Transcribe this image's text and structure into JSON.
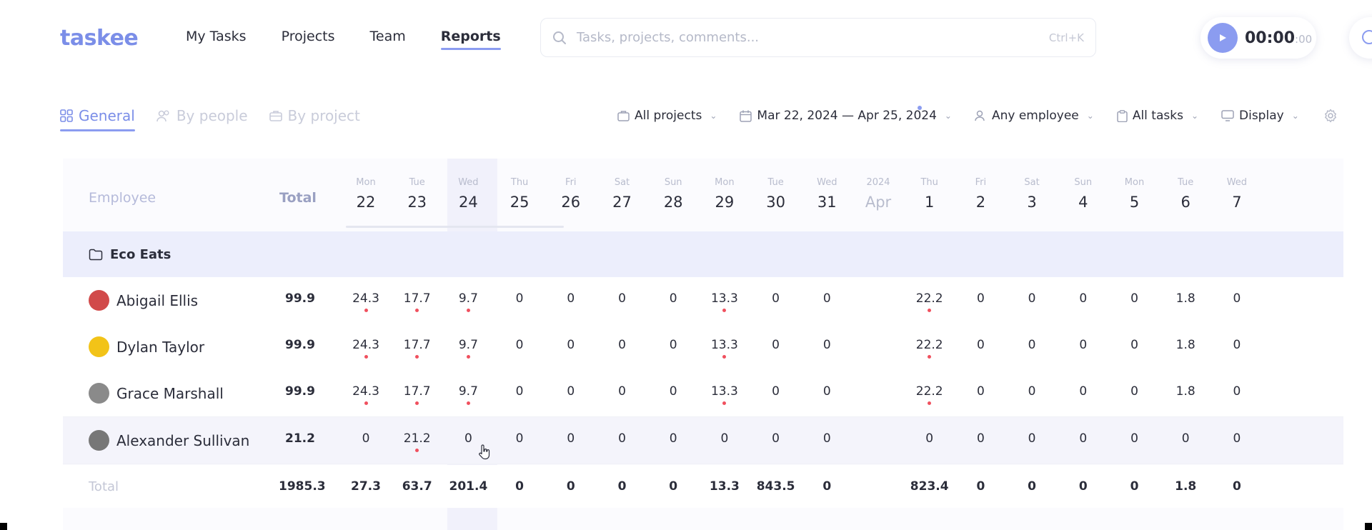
{
  "app": {
    "logo": "taskee"
  },
  "nav": {
    "items": [
      {
        "label": "My Tasks"
      },
      {
        "label": "Projects"
      },
      {
        "label": "Team"
      },
      {
        "label": "Reports"
      }
    ],
    "active": "Reports"
  },
  "search": {
    "placeholder": "Tasks, projects, comments...",
    "shortcut": "Ctrl+K"
  },
  "timer": {
    "main": "00:00",
    "seconds": ":00"
  },
  "view_tabs": [
    {
      "label": "General"
    },
    {
      "label": "By people"
    },
    {
      "label": "By project"
    }
  ],
  "filters": {
    "projects": "All projects",
    "date_range": "Mar 22, 2024 — Apr 25, 2024",
    "employee": "Any employee",
    "tasks": "All tasks",
    "display": "Display"
  },
  "table": {
    "employee_header": "Employee",
    "total_header": "Total",
    "days": [
      {
        "dow": "Mon",
        "day": "22"
      },
      {
        "dow": "Tue",
        "day": "23"
      },
      {
        "dow": "Wed",
        "day": "24"
      },
      {
        "dow": "Thu",
        "day": "25"
      },
      {
        "dow": "Fri",
        "day": "26"
      },
      {
        "dow": "Sat",
        "day": "27"
      },
      {
        "dow": "Sun",
        "day": "28"
      },
      {
        "dow": "Mon",
        "day": "29"
      },
      {
        "dow": "Tue",
        "day": "30"
      },
      {
        "dow": "Wed",
        "day": "31"
      },
      {
        "dow": "2024",
        "day": "Apr"
      },
      {
        "dow": "Thu",
        "day": "1"
      },
      {
        "dow": "Fri",
        "day": "2"
      },
      {
        "dow": "Sat",
        "day": "3"
      },
      {
        "dow": "Sun",
        "day": "4"
      },
      {
        "dow": "Mon",
        "day": "5"
      },
      {
        "dow": "Tue",
        "day": "6"
      },
      {
        "dow": "Wed",
        "day": "7"
      }
    ],
    "project": "Eco Eats",
    "rows": [
      {
        "name": "Abigail Ellis",
        "total": "99.9",
        "cells": [
          "24.3",
          "17.7",
          "9.7",
          "0",
          "0",
          "0",
          "0",
          "13.3",
          "0",
          "0",
          "",
          "22.2",
          "0",
          "0",
          "0",
          "0",
          "1.8",
          "0"
        ],
        "dots": [
          0,
          1,
          2,
          7,
          11
        ]
      },
      {
        "name": "Dylan Taylor",
        "total": "99.9",
        "cells": [
          "24.3",
          "17.7",
          "9.7",
          "0",
          "0",
          "0",
          "0",
          "13.3",
          "0",
          "0",
          "",
          "22.2",
          "0",
          "0",
          "0",
          "0",
          "1.8",
          "0"
        ],
        "dots": [
          0,
          1,
          2,
          7,
          11
        ]
      },
      {
        "name": "Grace Marshall",
        "total": "99.9",
        "cells": [
          "24.3",
          "17.7",
          "9.7",
          "0",
          "0",
          "0",
          "0",
          "13.3",
          "0",
          "0",
          "",
          "22.2",
          "0",
          "0",
          "0",
          "0",
          "1.8",
          "0"
        ],
        "dots": [
          0,
          1,
          2,
          7,
          11
        ]
      },
      {
        "name": "Alexander Sullivan",
        "total": "21.2",
        "cells": [
          "0",
          "21.2",
          "0",
          "0",
          "0",
          "0",
          "0",
          "0",
          "0",
          "0",
          "",
          "0",
          "0",
          "0",
          "0",
          "0",
          "0",
          "0"
        ],
        "dots": [
          1
        ]
      }
    ],
    "total_label": "Total",
    "grand_total": "1985.3",
    "totals": [
      "27.3",
      "63.7",
      "201.4",
      "0",
      "0",
      "0",
      "0",
      "13.3",
      "843.5",
      "0",
      "",
      "823.4",
      "0",
      "0",
      "0",
      "0",
      "1.8",
      "0"
    ]
  },
  "colors": {
    "accent": "#8b9cf0",
    "dot": "#f0505e",
    "avatars": [
      "#d14a4a",
      "#f2c318",
      "#8a8a8a",
      "#777777"
    ]
  }
}
